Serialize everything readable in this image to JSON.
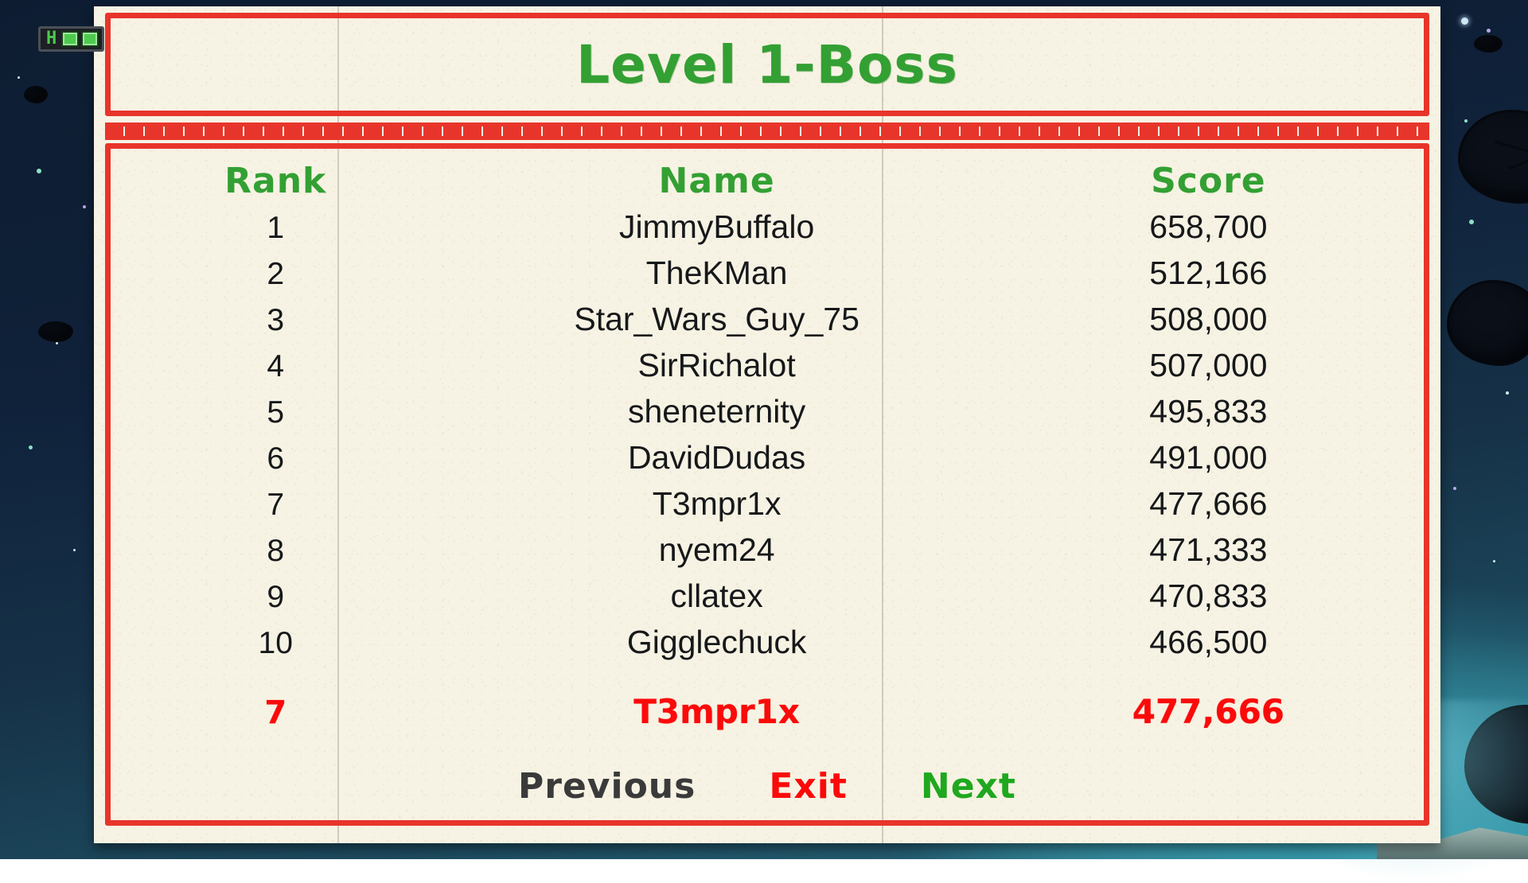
{
  "hud": {
    "health_letter": "H",
    "health_cells": 2
  },
  "board": {
    "title": "Level 1-Boss",
    "headers": {
      "rank": "Rank",
      "name": "Name",
      "score": "Score"
    },
    "rows": [
      {
        "rank": "1",
        "name": "JimmyBuffalo",
        "score": "658,700"
      },
      {
        "rank": "2",
        "name": "TheKMan",
        "score": "512,166"
      },
      {
        "rank": "3",
        "name": "Star_Wars_Guy_75",
        "score": "508,000"
      },
      {
        "rank": "4",
        "name": "SirRichalot",
        "score": "507,000"
      },
      {
        "rank": "5",
        "name": "sheneternity",
        "score": "495,833"
      },
      {
        "rank": "6",
        "name": "DavidDudas",
        "score": "491,000"
      },
      {
        "rank": "7",
        "name": "T3mpr1x",
        "score": "477,666"
      },
      {
        "rank": "8",
        "name": "nyem24",
        "score": "471,333"
      },
      {
        "rank": "9",
        "name": "cllatex",
        "score": "470,833"
      },
      {
        "rank": "10",
        "name": "Gigglechuck",
        "score": "466,500"
      }
    ],
    "player_row": {
      "rank": "7",
      "name": "T3mpr1x",
      "score": "477,666"
    }
  },
  "nav": {
    "previous": "Previous",
    "exit": "Exit",
    "next": "Next"
  },
  "colors": {
    "ink_red": "#e8352b",
    "title_green": "#33a033",
    "player_red": "#fb0a0a",
    "next_green": "#1fa81f",
    "previous_gray": "#3a3a3a",
    "paper": "#f7f3e4",
    "hud_green": "#4ec94e"
  }
}
